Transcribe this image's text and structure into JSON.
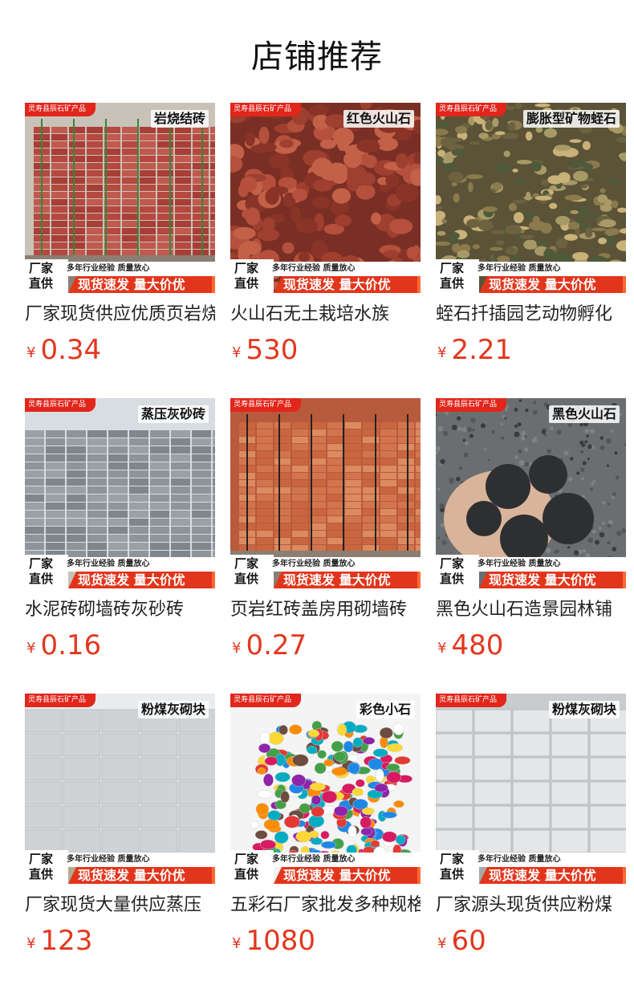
{
  "page_title": "店铺推荐",
  "products": [
    {
      "store_tag": "灵寿县辰石矿产品",
      "caption": "岩烧结砖",
      "promo_factory_1": "厂家",
      "promo_factory_2": "直供",
      "promo_top": "多年行业经验 质量放心",
      "promo_bottom": "现货速发 量大价优",
      "name": "厂家现货供应优质页岩烧结砖",
      "currency": "¥",
      "price": "0.34",
      "palette": "brick"
    },
    {
      "store_tag": "灵寿县辰石矿产品",
      "caption": "红色火山石",
      "promo_factory_1": "厂家",
      "promo_factory_2": "直供",
      "promo_top": "多年行业经验 质量放心",
      "promo_bottom": "现货速发 量大价优",
      "name": "火山石无土栽培水族",
      "currency": "¥",
      "price": "530",
      "palette": "lava-red"
    },
    {
      "store_tag": "灵寿县辰石矿产品",
      "caption": "膨胀型矿物蛭石",
      "promo_factory_1": "厂家",
      "promo_factory_2": "直供",
      "promo_top": "多年行业经验 质量放心",
      "promo_bottom": "现货速发 量大价优",
      "name": "蛭石扦插园艺动物孵化",
      "currency": "¥",
      "price": "2.21",
      "palette": "vermiculite"
    },
    {
      "store_tag": "灵寿县辰石矿产品",
      "caption": "蒸压灰砂砖",
      "promo_factory_1": "厂家",
      "promo_factory_2": "直供",
      "promo_top": "多年行业经验 质量放心",
      "promo_bottom": "现货速发 量大价优",
      "name": "水泥砖砌墙砖灰砂砖",
      "currency": "¥",
      "price": "0.16",
      "palette": "gray-brick"
    },
    {
      "store_tag": "灵寿县辰石矿产品",
      "caption": "",
      "promo_factory_1": "厂家",
      "promo_factory_2": "直供",
      "promo_top": "多年行业经验 质量放心",
      "promo_bottom": "现货速发 量大价优",
      "name": "页岩红砖盖房用砌墙砖",
      "currency": "¥",
      "price": "0.27",
      "palette": "red-brick"
    },
    {
      "store_tag": "灵寿县辰石矿产品",
      "caption": "黑色火山石",
      "promo_factory_1": "厂家",
      "promo_factory_2": "直供",
      "promo_top": "多年行业经验 质量放心",
      "promo_bottom": "现货速发 量大价优",
      "name": "黑色火山石造景园林铺",
      "currency": "¥",
      "price": "480",
      "palette": "lava-black"
    },
    {
      "store_tag": "灵寿县辰石矿产品",
      "caption": "粉煤灰砌块",
      "promo_factory_1": "厂家",
      "promo_factory_2": "直供",
      "promo_top": "多年行业经验 质量放心",
      "promo_bottom": "现货速发 量大价优",
      "name": "厂家现货大量供应蒸压",
      "currency": "¥",
      "price": "123",
      "palette": "block-gray"
    },
    {
      "store_tag": "灵寿县辰石矿产品",
      "caption": "彩色小石",
      "promo_factory_1": "厂家",
      "promo_factory_2": "直供",
      "promo_top": "多年行业经验 质量放心",
      "promo_bottom": "现货速发 量大价优",
      "name": "五彩石厂家批发多种规格",
      "currency": "¥",
      "price": "1080",
      "palette": "colorful"
    },
    {
      "store_tag": "灵寿县辰石矿产品",
      "caption": "粉煤灰砌块",
      "promo_factory_1": "厂家",
      "promo_factory_2": "直供",
      "promo_top": "多年行业经验 质量放心",
      "promo_bottom": "现货速发 量大价优",
      "name": "厂家源头现货供应粉煤",
      "currency": "¥",
      "price": "60",
      "palette": "block-white"
    }
  ],
  "colors": {
    "accent": "#e3371f",
    "tag_red": "#e2261c"
  }
}
